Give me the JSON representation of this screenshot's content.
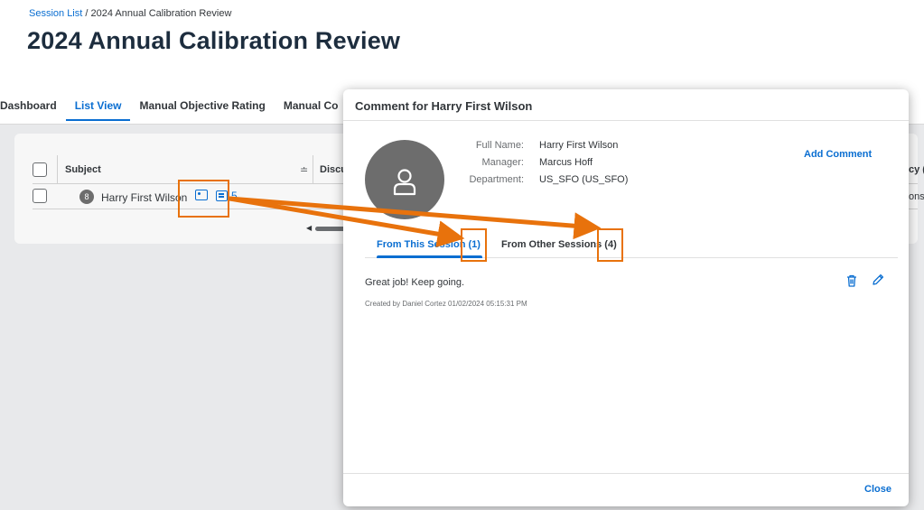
{
  "breadcrumb": {
    "link": "Session List",
    "separator": "/",
    "current": "2024 Annual Calibration Review"
  },
  "page": {
    "title": "2024 Annual Calibration Review",
    "tabs": [
      {
        "label": "Dashboard",
        "active": false
      },
      {
        "label": "List View",
        "active": true
      },
      {
        "label": "Manual Objective Rating",
        "active": false
      },
      {
        "label": "Manual Co",
        "active": false
      }
    ]
  },
  "table": {
    "columns": {
      "subject": "Subject",
      "discussed": "Discussed",
      "right_fragment": "cy ("
    },
    "rows": [
      {
        "avatar_initial": "8",
        "subject": "Harry First Wilson",
        "comment_count": "5",
        "right_fragment": "ons"
      }
    ]
  },
  "dialog": {
    "title": "Comment for Harry First Wilson",
    "fields": [
      {
        "label": "Full Name:",
        "value": "Harry First Wilson"
      },
      {
        "label": "Manager:",
        "value": "Marcus Hoff"
      },
      {
        "label": "Department:",
        "value": "US_SFO (US_SFO)"
      }
    ],
    "add_comment": "Add Comment",
    "tabs": [
      {
        "label": "From This Session (1)",
        "active": true
      },
      {
        "label": "From Other Sessions (4)",
        "active": false
      }
    ],
    "comment": {
      "text": "Great job! Keep going.",
      "meta": "Created by Daniel Cortez 01/02/2024 05:15:31 PM"
    },
    "close": "Close"
  },
  "icons": [
    "person-icon",
    "id-card-icon",
    "comment-icon",
    "sort-icon",
    "trash-icon",
    "pencil-icon",
    "scroll-left-arrow-icon"
  ],
  "colors": {
    "accent": "#0a6ed1",
    "annotation": "#e8720c",
    "avatar": "#6d6d6d"
  }
}
